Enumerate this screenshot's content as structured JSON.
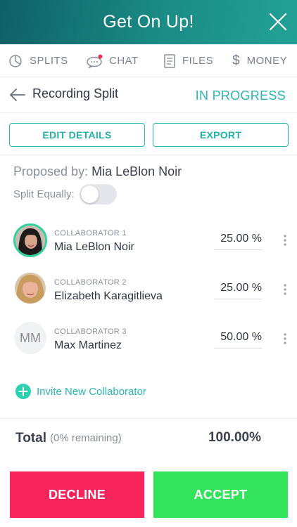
{
  "header": {
    "title": "Get On Up!"
  },
  "tabs": [
    {
      "label": "SPLITS",
      "icon": "pie-chart-icon"
    },
    {
      "label": "CHAT",
      "icon": "chat-bubble-icon",
      "has_notification": true
    },
    {
      "label": "FILES",
      "icon": "document-icon"
    },
    {
      "label": "MONEY",
      "icon": "dollar-icon"
    }
  ],
  "subheader": {
    "title": "Recording Split",
    "status": "IN PROGRESS"
  },
  "actions": {
    "edit_label": "EDIT DETAILS",
    "export_label": "EXPORT"
  },
  "proposal": {
    "prefix": "Proposed by:",
    "name": "Mia LeBlon Noir"
  },
  "split_equally": {
    "label": "Split Equally:",
    "enabled": false
  },
  "collaborators": [
    {
      "role": "COLLABORATOR 1",
      "name": "Mia LeBlon Noir",
      "percent": "25.00 %"
    },
    {
      "role": "COLLABORATOR 2",
      "name": "Elizabeth Karagitlieva",
      "percent": "25.00 %"
    },
    {
      "role": "COLLABORATOR 3",
      "name": "Max Martinez",
      "percent": "50.00 %",
      "initials": "MM"
    }
  ],
  "invite": {
    "label": "Invite New Collaborator"
  },
  "total": {
    "label": "Total",
    "remaining": "(0% remaining)",
    "value": "100.00%"
  },
  "buttons": {
    "decline_label": "DECLINE",
    "accept_label": "ACCEPT"
  },
  "colors": {
    "teal_accent": "#2ab6b2",
    "header_gradient_start": "#0e5f66",
    "header_gradient_end": "#23a195",
    "decline": "#f7245c",
    "accept": "#33e35b",
    "notification_dot": "#e8304f",
    "avatar_ring": "#2ed29a"
  }
}
